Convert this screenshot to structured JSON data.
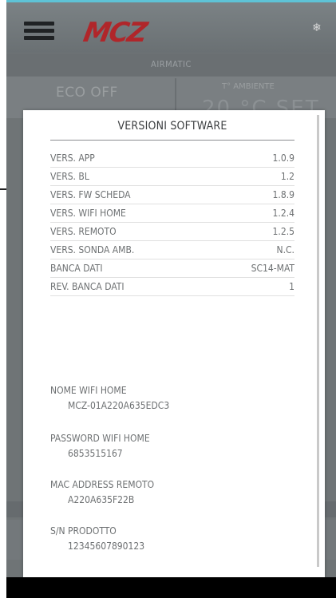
{
  "header": {
    "brand": "MCZ"
  },
  "mode_bar": {
    "label": "AIRMATIC"
  },
  "status": {
    "eco": "ECO OFF",
    "ambient_label": "T° AMBIENTE",
    "ambient_value": "20 °C  SET"
  },
  "dialog": {
    "title": "VERSIONI SOFTWARE",
    "rows": [
      {
        "label": "VERS. APP",
        "value": "1.0.9"
      },
      {
        "label": "VERS. BL",
        "value": "1.2"
      },
      {
        "label": "VERS. FW SCHEDA",
        "value": "1.8.9"
      },
      {
        "label": "VERS. WIFI HOME",
        "value": "1.2.4"
      },
      {
        "label": "VERS. REMOTO",
        "value": "1.2.5"
      },
      {
        "label": "VERS. SONDA AMB.",
        "value": "N.C."
      },
      {
        "label": "BANCA DATI",
        "value": "SC14-MAT"
      },
      {
        "label": "REV. BANCA DATI",
        "value": "1"
      }
    ],
    "info": [
      {
        "label": "NOME WIFI HOME",
        "value": "MCZ-01A220A635EDC3"
      },
      {
        "label": "PASSWORD WIFI HOME",
        "value": "6853515167"
      },
      {
        "label": "MAC ADDRESS REMOTO",
        "value": "A220A635F22B"
      },
      {
        "label": "S/N PRODOTTO",
        "value": "12345607890123"
      }
    ]
  }
}
